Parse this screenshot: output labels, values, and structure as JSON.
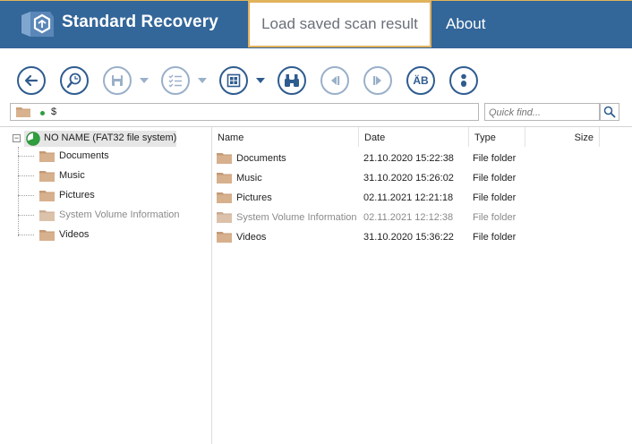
{
  "header": {
    "app_title": "Standard Recovery",
    "tab_load_saved": "Load saved scan result",
    "tab_about": "About",
    "colors": {
      "bar": "#336699",
      "tab_border": "#e3b15c"
    }
  },
  "toolbar": {
    "buttons": [
      {
        "icon": "back-arrow-icon"
      },
      {
        "icon": "search-magnifier-icon"
      },
      {
        "icon": "save-disk-icon",
        "disabled": true
      },
      {
        "icon": "checklist-icon",
        "disabled": true
      },
      {
        "icon": "view-mode-icon"
      },
      {
        "icon": "binoculars-icon"
      },
      {
        "icon": "previous-icon",
        "disabled": true
      },
      {
        "icon": "next-icon",
        "disabled": true
      },
      {
        "icon": "case-sensitive-icon",
        "text": "ÄB"
      },
      {
        "icon": "info-icon"
      }
    ]
  },
  "path": {
    "value": "$"
  },
  "search": {
    "placeholder": "Quick find..."
  },
  "tree": {
    "root_label": "NO NAME (FAT32 file system)",
    "items": [
      {
        "label": "Documents",
        "muted": false
      },
      {
        "label": "Music",
        "muted": false
      },
      {
        "label": "Pictures",
        "muted": false
      },
      {
        "label": "System Volume Information",
        "muted": true
      },
      {
        "label": "Videos",
        "muted": false
      }
    ]
  },
  "list": {
    "columns": {
      "name": "Name",
      "date": "Date",
      "type": "Type",
      "size": "Size"
    },
    "rows": [
      {
        "name": "Documents",
        "date": "21.10.2020 15:22:38",
        "type": "File folder",
        "muted": false
      },
      {
        "name": "Music",
        "date": "31.10.2020 15:26:02",
        "type": "File folder",
        "muted": false
      },
      {
        "name": "Pictures",
        "date": "02.11.2021 12:21:18",
        "type": "File folder",
        "muted": false
      },
      {
        "name": "System Volume Information",
        "date": "02.11.2021 12:12:38",
        "type": "File folder",
        "muted": true
      },
      {
        "name": "Videos",
        "date": "31.10.2020 15:36:22",
        "type": "File folder",
        "muted": false
      }
    ]
  }
}
